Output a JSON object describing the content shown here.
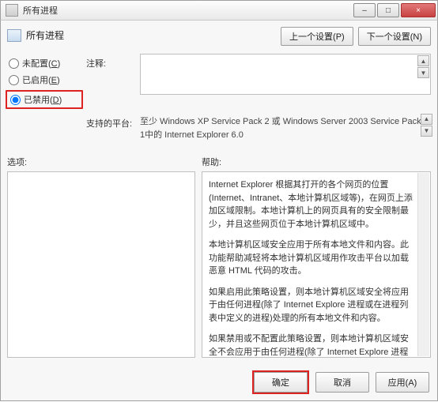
{
  "window": {
    "title": "所有进程",
    "min": "–",
    "max": "□",
    "close": "×"
  },
  "header": {
    "icon": "process-list-icon",
    "label": "所有进程"
  },
  "nav": {
    "prev": "上一个设置(P)",
    "next": "下一个设置(N)"
  },
  "radios": {
    "unconfigured": "未配置",
    "unconfigured_key": "C",
    "enabled": "已启用",
    "enabled_key": "E",
    "disabled": "已禁用",
    "disabled_key": "D"
  },
  "labels": {
    "notes": "注释:",
    "platform": "支持的平台:",
    "options": "选项:",
    "help": "帮助:"
  },
  "platform_text": "至少 Windows XP Service Pack 2 或 Windows Server 2003 Service Pack 1中的 Internet Explorer 6.0",
  "help": {
    "p1": "Internet Explorer 根据其打开的各个网页的位置(Internet、Intranet、本地计算机区域等)，在网页上添加区域限制。本地计算机上的网页具有的安全限制最少，并且这些网页位于本地计算机区域中。",
    "p2": "本地计算机区域安全应用于所有本地文件和内容。此功能帮助减轻将本地计算机区域用作攻击平台以加载恶意 HTML 代码的攻击。",
    "p3": "如果启用此策略设置，则本地计算机区域安全将应用于由任何进程(除了 Internet Explore 进程或在进程列表中定义的进程)处理的所有本地文件和内容。",
    "p4": "如果禁用或不配置此策略设置，则本地计算机区域安全不会应用于由任何进程(除了 Internet Explore 进程或在进程列表中定义的进程)处理的本地文件和内容。"
  },
  "footer": {
    "ok": "确定",
    "cancel": "取消",
    "apply": "应用(A)"
  }
}
